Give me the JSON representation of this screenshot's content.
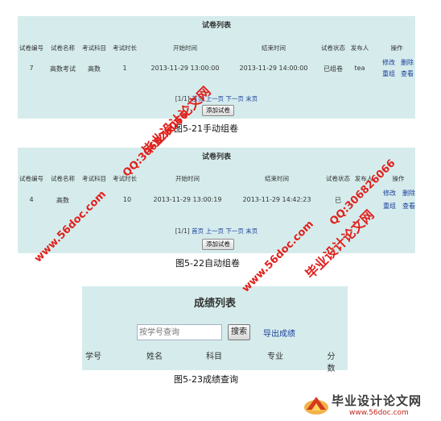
{
  "exam_list_manual": {
    "title": "试卷列表",
    "columns": [
      "试卷编号",
      "试卷名称",
      "考试科目",
      "考试时长",
      "开始时间",
      "结束时间",
      "试卷状态",
      "发布人",
      "操作"
    ],
    "row": {
      "id": "7",
      "name": "高数考试",
      "subject": "高数",
      "duration": "1",
      "start": "2013-11-29 13:00:00",
      "end": "2013-11-29 14:00:00",
      "status": "已组卷",
      "publisher": "tea",
      "actions": [
        "修改",
        "删除",
        "重组",
        "查看"
      ]
    },
    "pager": {
      "page": "[1/1]",
      "first": "首页",
      "prev": "上一页",
      "next": "下一页",
      "last": "末页"
    },
    "add_button": "添加试卷",
    "caption": "图5-21手动组卷"
  },
  "exam_list_auto": {
    "title": "试卷列表",
    "columns": [
      "试卷编号",
      "试卷名称",
      "考试科目",
      "考试时长",
      "开始时间",
      "结束时间",
      "试卷状态",
      "发布人",
      "操作"
    ],
    "row": {
      "id": "4",
      "name": "高数",
      "subject": "",
      "duration": "10",
      "start": "2013-11-29 13:00:19",
      "end": "2013-11-29 14:42:23",
      "status": "已",
      "publisher": "",
      "actions": [
        "修改",
        "删除",
        "重组",
        "查看"
      ]
    },
    "pager": {
      "page": "[1/1]",
      "first": "首页",
      "prev": "上一页",
      "next": "下一页",
      "last": "末页"
    },
    "add_button": "添加试卷",
    "caption": "图5-22自动组卷"
  },
  "score_list": {
    "title": "成绩列表",
    "search_placeholder": "按学号查询",
    "search_button": "搜索",
    "export_link": "导出成绩",
    "columns": [
      "学号",
      "姓名",
      "科目",
      "专业",
      "分数"
    ],
    "caption": "图5-23成绩查询"
  },
  "watermarks": {
    "site": "www.56doc.com",
    "qq": "QQ:306826066",
    "brand": "毕业设计论文网"
  },
  "logo": {
    "name": "毕业设计论文网",
    "url": "www.56doc.com"
  }
}
